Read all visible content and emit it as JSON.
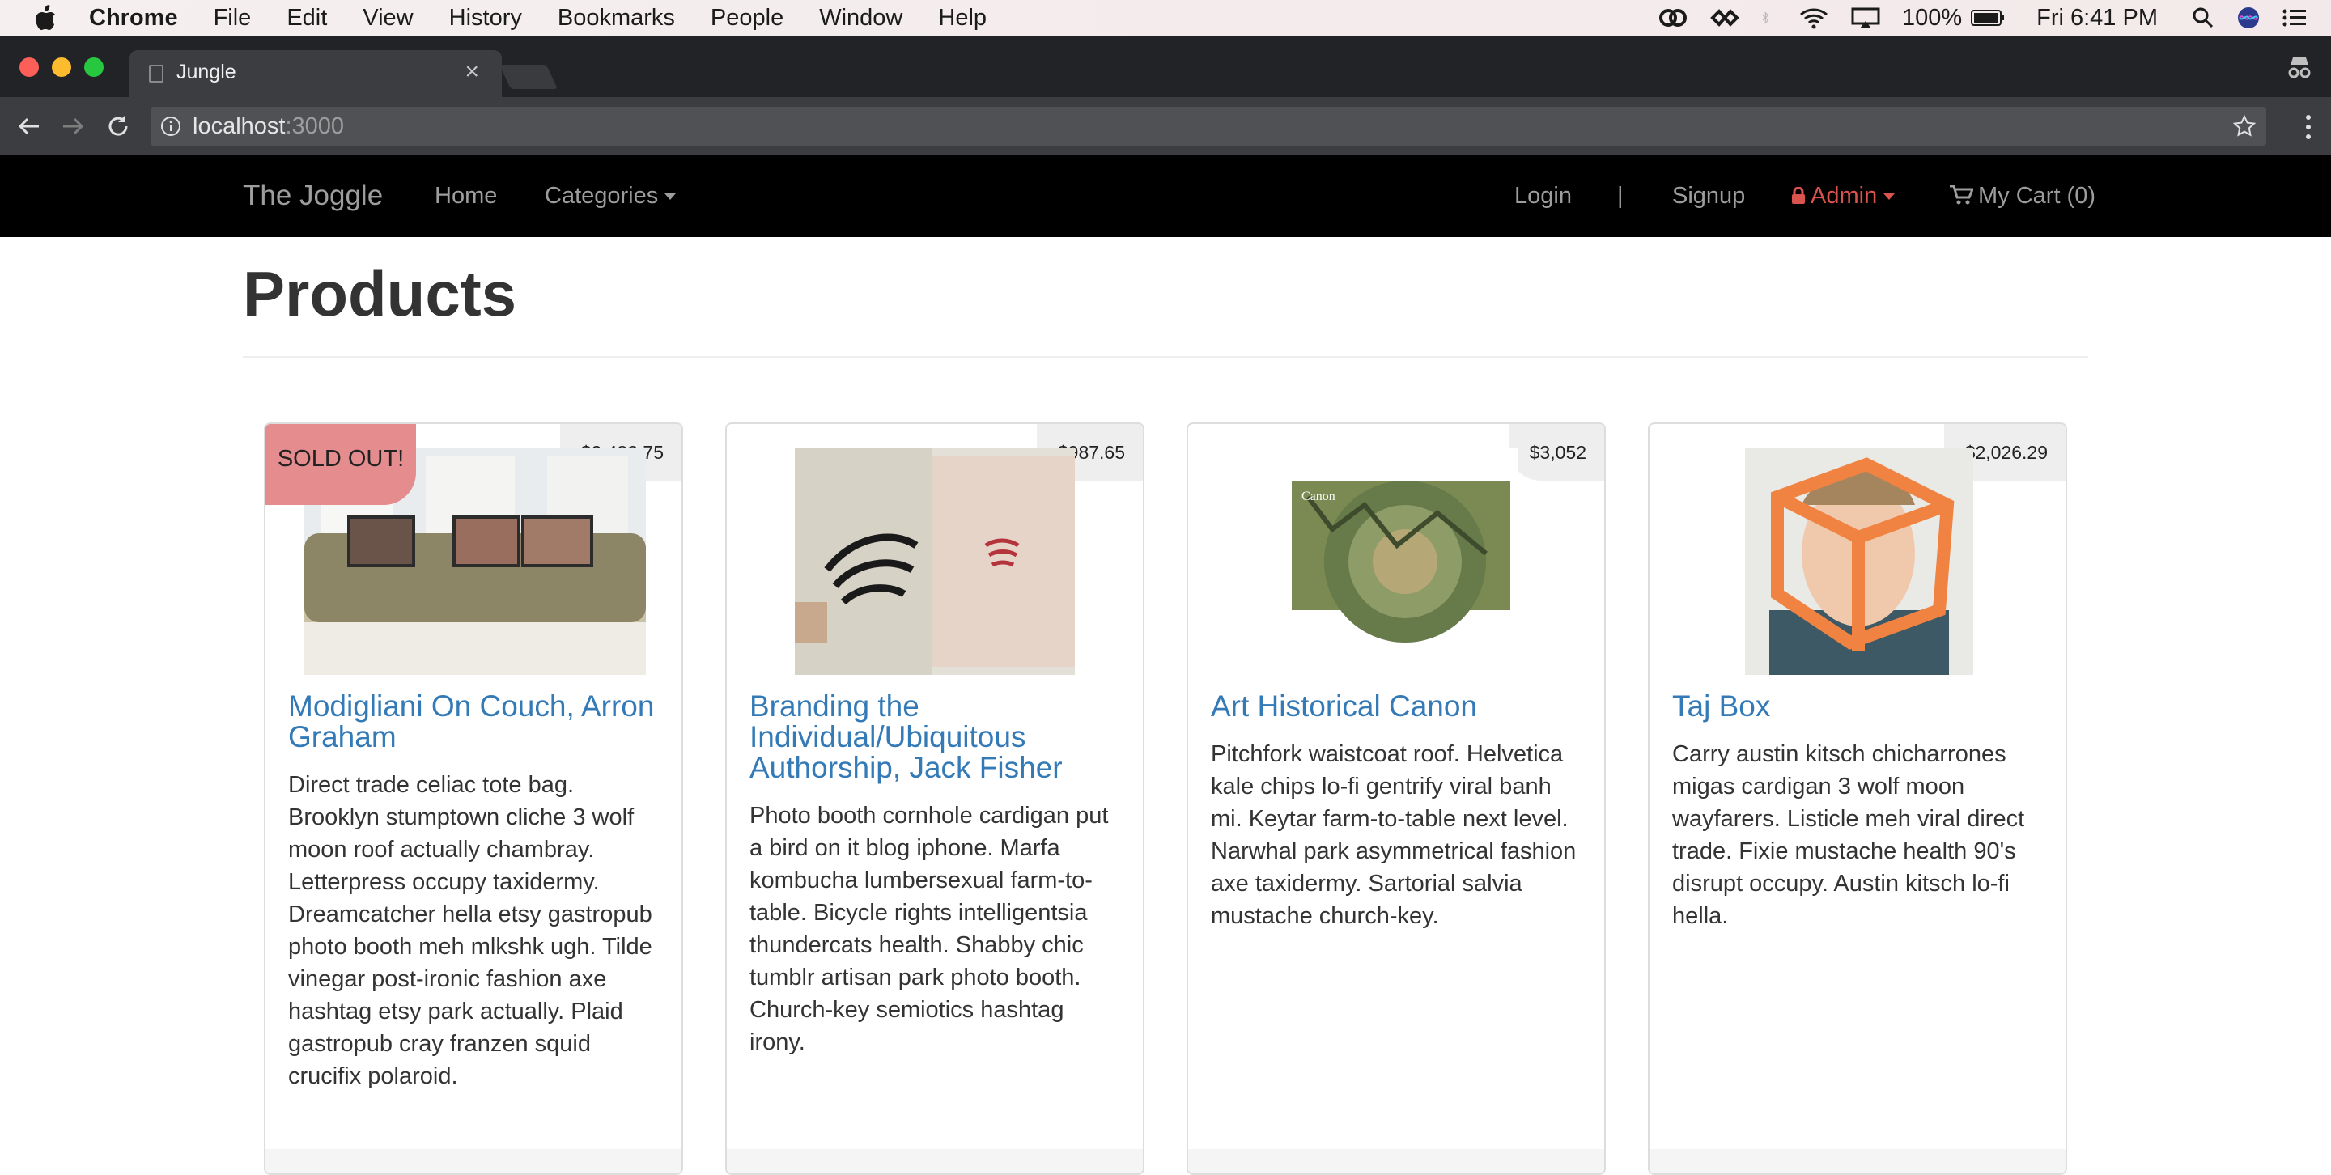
{
  "menubar": {
    "app": "Chrome",
    "menus": [
      "File",
      "Edit",
      "View",
      "History",
      "Bookmarks",
      "People",
      "Window",
      "Help"
    ],
    "battery": "100%",
    "clock": "Fri 6:41 PM"
  },
  "browser": {
    "tab_title": "Jungle",
    "url_host": "localhost",
    "url_port": ":3000"
  },
  "navbar": {
    "brand": "The Joggle",
    "home": "Home",
    "categories": "Categories",
    "login": "Login",
    "separator": "|",
    "signup": "Signup",
    "admin": "Admin",
    "cart": "My Cart (0)"
  },
  "page": {
    "title": "Products"
  },
  "products": [
    {
      "name": "Modigliani On Couch, Arron Graham",
      "price": "$2,483.75",
      "badge": "SOLD OUT!",
      "description": "Direct trade celiac tote bag. Brooklyn stumptown cliche 3 wolf moon roof actually chambray. Letterpress occupy taxidermy. Dreamcatcher hella etsy gastropub photo booth meh mlkshk ugh. Tilde vinegar post-ironic fashion axe hashtag etsy park actually. Plaid gastropub cray franzen squid crucifix polaroid."
    },
    {
      "name": "Branding the Individual/Ubiquitous Authorship, Jack Fisher",
      "price": "$987.65",
      "description": "Photo booth cornhole cardigan put a bird on it blog iphone. Marfa kombucha lumbersexual farm-to-table. Bicycle rights intelligentsia thundercats health. Shabby chic tumblr artisan park photo booth. Church-key semiotics hashtag irony."
    },
    {
      "name": "Art Historical Canon",
      "price": "$3,052",
      "description": "Pitchfork waistcoat roof. Helvetica kale chips lo-fi gentrify viral banh mi. Keytar farm-to-table next level. Narwhal park asymmetrical fashion axe taxidermy. Sartorial salvia mustache church-key."
    },
    {
      "name": "Taj Box",
      "price": "$2,026.29",
      "description": "Carry austin kitsch chicharrones migas cardigan 3 wolf moon wayfarers. Listicle meh viral direct trade. Fixie mustache health 90's disrupt occupy. Austin kitsch lo-fi hella."
    }
  ],
  "colors": {
    "link": "#337ab7",
    "admin": "#d9534f",
    "sold_out": "#e58c8f",
    "navbar_bg": "#000000"
  }
}
